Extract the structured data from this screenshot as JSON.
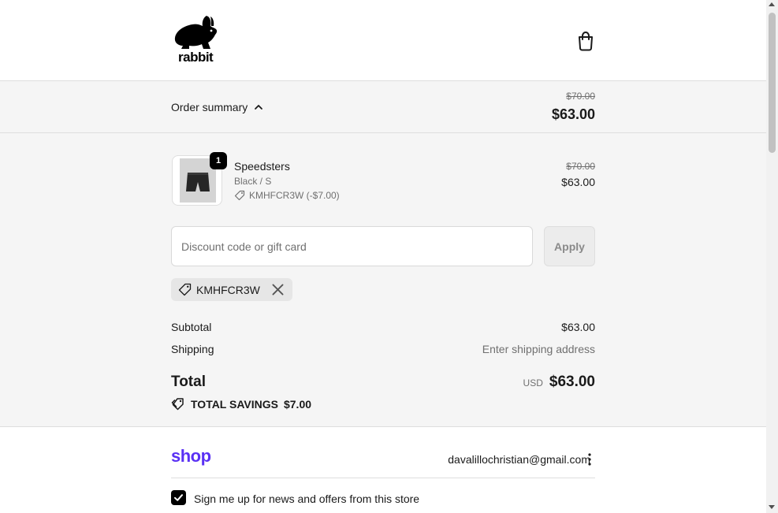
{
  "brand": {
    "name": "rabbit"
  },
  "header": {
    "cart_icon": "shopping-bag-icon"
  },
  "summary_bar": {
    "toggle_label": "Order summary",
    "original_total": "$70.00",
    "total": "$63.00"
  },
  "line_item": {
    "quantity": "1",
    "name": "Speedsters",
    "variant": "Black / S",
    "discount": "KMHFCR3W (-$7.00)",
    "original_price": "$70.00",
    "price": "$63.00"
  },
  "discount": {
    "placeholder": "Discount code or gift card",
    "value": "",
    "apply_label": "Apply",
    "applied_code": "KMHFCR3W"
  },
  "totals": {
    "subtotal_label": "Subtotal",
    "subtotal_value": "$63.00",
    "shipping_label": "Shipping",
    "shipping_value": "Enter shipping address",
    "total_label": "Total",
    "currency": "USD",
    "total_value": "$63.00",
    "savings_label": "TOTAL SAVINGS",
    "savings_value": "$7.00"
  },
  "shop_pay": {
    "logo_text": "shop",
    "email": "davalillochristian@gmail.com"
  },
  "marketing": {
    "checked": true,
    "label": "Sign me up for news and offers from this store"
  },
  "colors": {
    "shop_purple": "#5a31f4",
    "summary_bg": "#f5f5f5",
    "text_muted": "#707070"
  }
}
